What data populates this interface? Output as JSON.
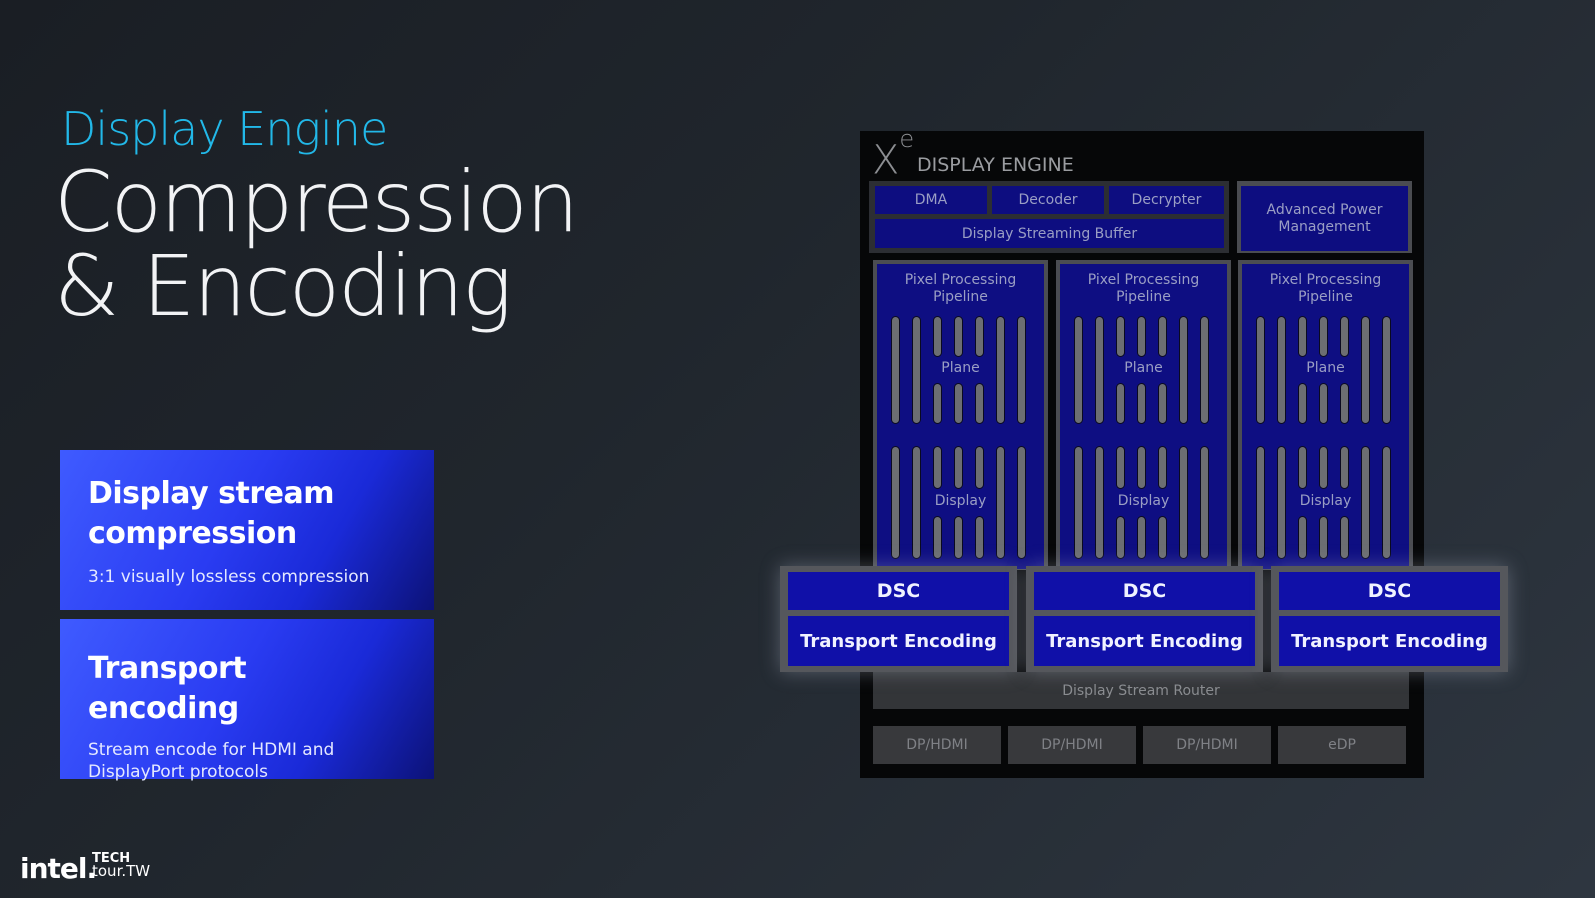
{
  "slide": {
    "kicker": "Display Engine",
    "title_line1": "Compression",
    "title_line2": "& Encoding"
  },
  "cards": [
    {
      "title_line1": "Display stream",
      "title_line2": "compression",
      "subtitle_line1": "3:1 visually lossless compression",
      "subtitle_line2": ""
    },
    {
      "title_line1": "Transport encoding",
      "title_line2": "",
      "subtitle_line1": "Stream encode for HDMI and",
      "subtitle_line2": "DisplayPort protocols"
    }
  ],
  "footer": {
    "logo": "intel.",
    "event_line1": "TECH",
    "event_line2": "tour.TW"
  },
  "diagram": {
    "xe_logo": "X",
    "xe_sup": "e",
    "title": "DISPLAY ENGINE",
    "top_blocks": [
      "DMA",
      "Decoder",
      "Decrypter"
    ],
    "buffer": "Display Streaming Buffer",
    "apm_line1": "Advanced Power",
    "apm_line2": "Management",
    "pipelines": [
      {
        "label_line1": "Pixel Processing",
        "label_line2": "Pipeline",
        "plane": "Plane",
        "display": "Display"
      },
      {
        "label_line1": "Pixel Processing",
        "label_line2": "Pipeline",
        "plane": "Plane",
        "display": "Display"
      },
      {
        "label_line1": "Pixel Processing",
        "label_line2": "Pipeline",
        "plane": "Plane",
        "display": "Display"
      }
    ],
    "encoders": [
      {
        "dsc": "DSC",
        "transport": "Transport Encoding"
      },
      {
        "dsc": "DSC",
        "transport": "Transport Encoding"
      },
      {
        "dsc": "DSC",
        "transport": "Transport Encoding"
      }
    ],
    "router": "Display Stream Router",
    "ports": [
      "DP/HDMI",
      "DP/HDMI",
      "DP/HDMI",
      "eDP"
    ]
  },
  "colors": {
    "kicker": "#22b8e8",
    "block_blue": "#0d0d80",
    "card_blue": "#2a3cf2"
  }
}
